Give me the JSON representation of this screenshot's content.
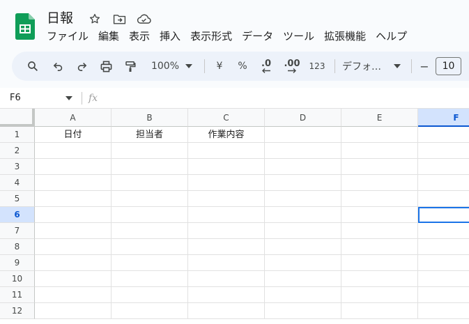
{
  "header": {
    "title": "日報",
    "icons": [
      "star-icon",
      "move-to-folder-icon",
      "cloud-saved-icon"
    ]
  },
  "menu": [
    "ファイル",
    "編集",
    "表示",
    "挿入",
    "表示形式",
    "データ",
    "ツール",
    "拡張機能",
    "ヘルプ"
  ],
  "toolbar": {
    "zoom": "100%",
    "currency": "¥",
    "percent": "%",
    "decrease_decimal": ".0",
    "increase_decimal": ".00",
    "number_format": "123",
    "font": "デフォ…",
    "font_size": "10",
    "minus": "−"
  },
  "formula_bar": {
    "name_box": "F6",
    "fx": "fx",
    "formula": ""
  },
  "sheet": {
    "columns": [
      "A",
      "B",
      "C",
      "D",
      "E",
      "F"
    ],
    "rows": [
      "1",
      "2",
      "3",
      "4",
      "5",
      "6",
      "7",
      "8",
      "9",
      "10",
      "11",
      "12"
    ],
    "selected_column": "F",
    "selected_row": "6",
    "cells": [
      [
        "日付",
        "担当者",
        "作業内容",
        "",
        "",
        ""
      ],
      [
        "",
        "",
        "",
        "",
        "",
        ""
      ],
      [
        "",
        "",
        "",
        "",
        "",
        ""
      ],
      [
        "",
        "",
        "",
        "",
        "",
        ""
      ],
      [
        "",
        "",
        "",
        "",
        "",
        ""
      ],
      [
        "",
        "",
        "",
        "",
        "",
        ""
      ],
      [
        "",
        "",
        "",
        "",
        "",
        ""
      ],
      [
        "",
        "",
        "",
        "",
        "",
        ""
      ],
      [
        "",
        "",
        "",
        "",
        "",
        ""
      ],
      [
        "",
        "",
        "",
        "",
        "",
        ""
      ],
      [
        "",
        "",
        "",
        "",
        "",
        ""
      ],
      [
        "",
        "",
        "",
        "",
        "",
        ""
      ]
    ]
  },
  "colors": {
    "brand_green": "#0f9d58",
    "selection_blue": "#1a73e8",
    "header_selected_bg": "#d3e3fd"
  }
}
